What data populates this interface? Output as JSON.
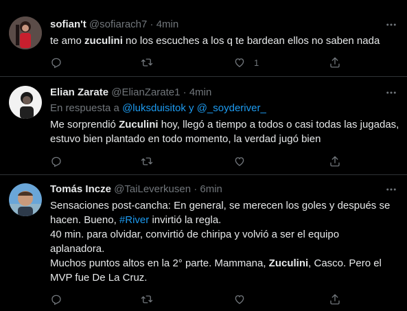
{
  "tweets": [
    {
      "name": "sofian't",
      "handle": "@sofiarach7",
      "separator": "·",
      "time": "4min",
      "text_parts": [
        "te amo ",
        "zuculini",
        " no los escuches a los q te bardean ellos no saben nada"
      ],
      "reply_count": "",
      "retweet_count": "",
      "like_count": "1"
    },
    {
      "name": "Elian Zarate",
      "handle": "@ElianZarate1",
      "separator": "·",
      "time": "4min",
      "reply_prefix": "En respuesta a ",
      "reply_user1": "@luksduisitok",
      "reply_and": " y ",
      "reply_user2": "@_soyderiver_",
      "line1_parts": [
        "Me sorprendió ",
        "Zuculini",
        " hoy, llegó a tiempo a todos o casi todas las jugadas,"
      ],
      "line2": "estuvo bien plantado en todo momento, la verdad jugó bien",
      "like_count": ""
    },
    {
      "name": "Tomás Incze",
      "handle": "@TaiLeverkusen",
      "separator": "·",
      "time": "6min",
      "line1": "Sensaciones post-cancha: En general, se merecen los goles y después se",
      "line2_parts": [
        "hacen. Bueno, ",
        "#River",
        " invirtió la regla."
      ],
      "line3": "40 min. para olvidar, convirtió de chiripa y volvió a ser el equipo",
      "line4": "aplanadora.",
      "line5_parts": [
        "Muchos puntos altos en la 2° parte. Mammana, ",
        "Zuculini",
        ", Casco. Pero el"
      ],
      "line6": "MVP fue De La Cruz.",
      "like_count": ""
    }
  ],
  "colors": {
    "background": "#000000",
    "text": "#e7e9ea",
    "secondary": "#71767b",
    "link": "#1d9bf0",
    "divider": "#2f3336"
  },
  "icons": [
    "reply-icon",
    "retweet-icon",
    "like-icon",
    "share-icon",
    "more-icon"
  ]
}
